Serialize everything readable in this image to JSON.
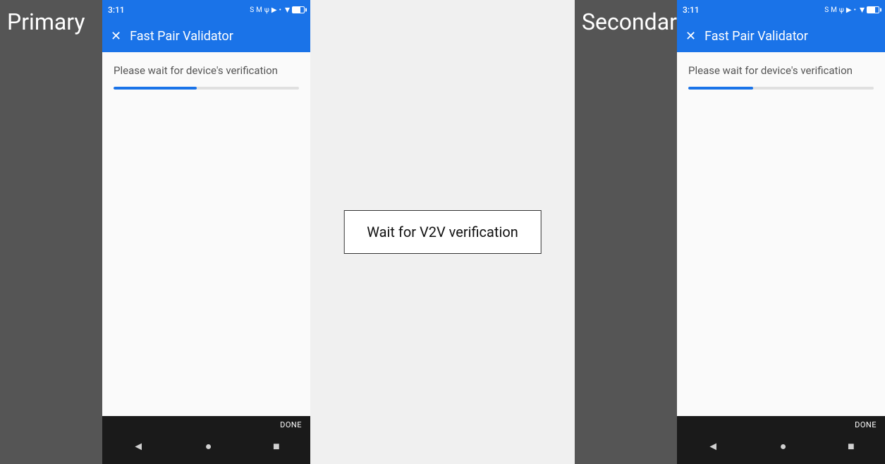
{
  "primary": {
    "label": "Primary",
    "status_bar": {
      "time": "3:11",
      "icons": "S M ψ ▶ •"
    },
    "app_bar": {
      "title": "Fast Pair Validator",
      "close_icon": "✕"
    },
    "content": {
      "verification_text": "Please wait for device's verification",
      "progress_fill_width": "45%"
    },
    "nav_bar": {
      "done_label": "DONE",
      "back_icon": "◄",
      "home_icon": "●",
      "recents_icon": "■"
    }
  },
  "secondary": {
    "label": "Secondary",
    "status_bar": {
      "time": "3:11",
      "icons": "S M ψ ▶ •"
    },
    "app_bar": {
      "title": "Fast Pair Validator",
      "close_icon": "✕"
    },
    "content": {
      "verification_text": "Please wait for device's verification",
      "progress_fill_width": "35%"
    },
    "nav_bar": {
      "done_label": "DONE",
      "back_icon": "◄",
      "home_icon": "●",
      "recents_icon": "■"
    }
  },
  "v2v_box": {
    "text": "Wait for V2V verification"
  }
}
